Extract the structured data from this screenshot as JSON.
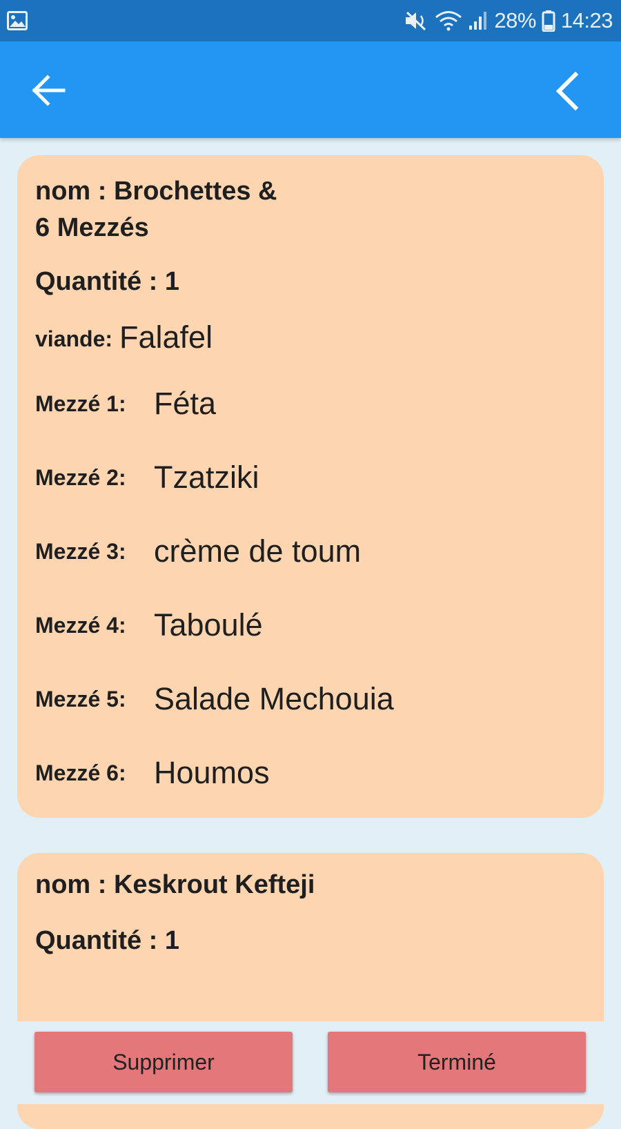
{
  "status_bar": {
    "left_icon": "image-icon",
    "icons": [
      "mute-icon",
      "wifi-icon",
      "signal-icon",
      "battery-icon"
    ],
    "battery_percent": "28%",
    "time": "14:23",
    "background": "#1C72BC"
  },
  "app_bar": {
    "back_icon": "arrow-left-icon",
    "right_icon": "chevron-left-icon",
    "background": "#2296F2"
  },
  "orders": [
    {
      "name_line": "nom : Brochettes &\n 6 Mezzés",
      "quantity_line": "Quantité : 1",
      "viande_label": "viande:",
      "viande_value": "Falafel",
      "mezzes": [
        {
          "label": "Mezzé 1:",
          "value": "Féta"
        },
        {
          "label": "Mezzé 2:",
          "value": "Tzatziki"
        },
        {
          "label": "Mezzé 3:",
          "value": "crème de toum"
        },
        {
          "label": "Mezzé 4:",
          "value": "Taboulé"
        },
        {
          "label": "Mezzé 5:",
          "value": "Salade Mechouia"
        },
        {
          "label": "Mezzé 6:",
          "value": "Houmos"
        }
      ]
    },
    {
      "name_line": "nom : Keskrout Kefteji",
      "quantity_line": "Quantité : 1"
    }
  ],
  "actions": {
    "delete_label": "Supprimer",
    "done_label": "Terminé",
    "button_color": "#E37779"
  },
  "card_color": "#FDD5B1",
  "page_background": "#E1F0F6"
}
